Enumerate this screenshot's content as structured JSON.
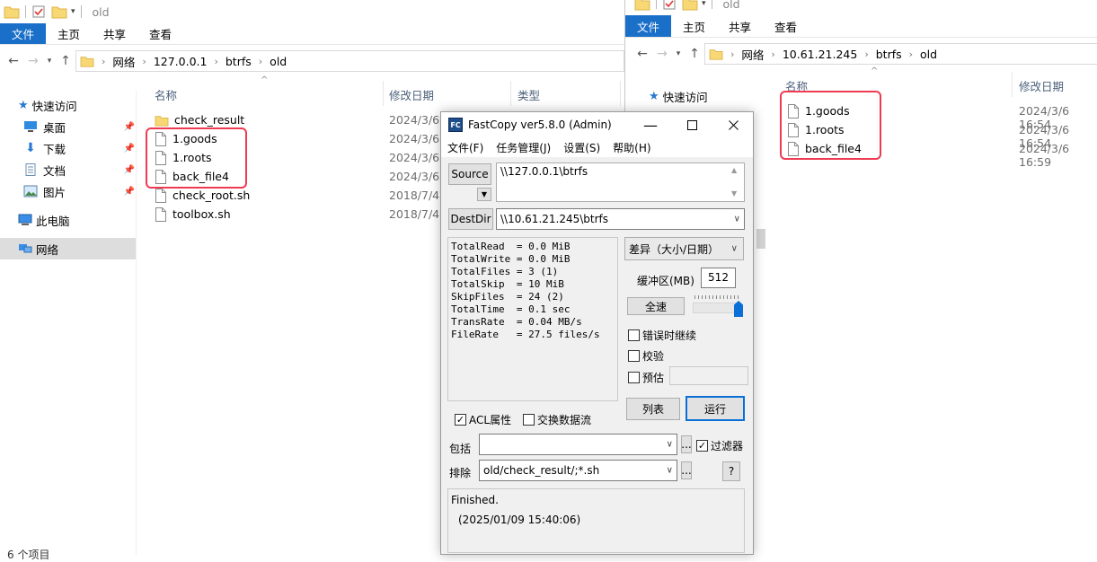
{
  "left_explorer": {
    "title": "old",
    "ribbon": [
      "文件",
      "主页",
      "共享",
      "查看"
    ],
    "breadcrumb": [
      "网络",
      "127.0.0.1",
      "btrfs",
      "old"
    ],
    "nav": [
      {
        "label": "快速访问",
        "icon": "star-icon"
      },
      {
        "label": "桌面",
        "icon": "desktop-icon"
      },
      {
        "label": "下载",
        "icon": "download-icon"
      },
      {
        "label": "文档",
        "icon": "document-icon"
      },
      {
        "label": "图片",
        "icon": "picture-icon"
      },
      {
        "label": "此电脑",
        "icon": "computer-icon"
      },
      {
        "label": "网络",
        "icon": "network-icon"
      }
    ],
    "columns": [
      "名称",
      "修改日期",
      "类型"
    ],
    "files": [
      {
        "name": "check_result",
        "date": "2024/3/6",
        "folder": true
      },
      {
        "name": "1.goods",
        "date": "2024/3/6",
        "folder": false
      },
      {
        "name": "1.roots",
        "date": "2024/3/6",
        "folder": false
      },
      {
        "name": "back_file4",
        "date": "2024/3/6",
        "folder": false
      },
      {
        "name": "check_root.sh",
        "date": "2018/7/4",
        "folder": false
      },
      {
        "name": "toolbox.sh",
        "date": "2018/7/4",
        "folder": false
      }
    ],
    "status": "6 个项目"
  },
  "right_explorer": {
    "title": "old",
    "ribbon": [
      "文件",
      "主页",
      "共享",
      "查看"
    ],
    "breadcrumb": [
      "网络",
      "10.61.21.245",
      "btrfs",
      "old"
    ],
    "nav": [
      {
        "label": "快速访问",
        "icon": "star-icon"
      }
    ],
    "columns": [
      "名称",
      "修改日期"
    ],
    "files": [
      {
        "name": "1.goods",
        "date": "2024/3/6 16:54"
      },
      {
        "name": "1.roots",
        "date": "2024/3/6 16:54"
      },
      {
        "name": "back_file4",
        "date": "2024/3/6 16:59"
      }
    ]
  },
  "fastcopy": {
    "icon_text": "FC",
    "title": "FastCopy ver5.8.0 (Admin)",
    "menu": [
      "文件(F)",
      "任务管理(J)",
      "设置(S)",
      "帮助(H)"
    ],
    "source_label": "Source",
    "source_value": "\\\\127.0.0.1\\btrfs",
    "dest_label": "DestDir",
    "dest_value": "\\\\10.61.21.245\\btrfs",
    "stats": "TotalRead  = 0.0 MiB\nTotalWrite = 0.0 MiB\nTotalFiles = 3 (1)\nTotalSkip  = 10 MiB\nSkipFiles  = 24 (2)\nTotalTime  = 0.1 sec\nTransRate  = 0.04 MB/s\nFileRate   = 27.5 files/s",
    "mode": "差异（大小/日期）",
    "buffer_label": "缓冲区(MB)",
    "buffer_value": "512",
    "fullspeed_label": "全速",
    "speed_fraction": 1.0,
    "opt_error_continue": "错误时继续",
    "opt_verify": "校验",
    "opt_estimate": "预估",
    "list_label": "列表",
    "run_label": "运行",
    "acl_label": "ACL属性",
    "ads_label": "交换数据流",
    "include_label": "包括",
    "include_value": "",
    "exclude_label": "排除",
    "exclude_value": "old/check_result/;*.sh",
    "filter_label": "过滤器",
    "ellipsis": "...",
    "help": "?",
    "log_line1": "Finished.",
    "log_line2": "(2025/01/09 15:40:06)"
  }
}
